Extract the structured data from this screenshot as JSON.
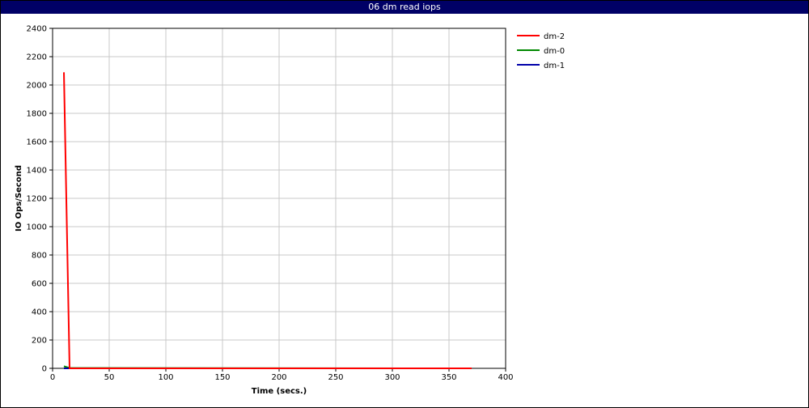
{
  "chart_data": {
    "type": "line",
    "title": "06 dm read iops",
    "xlabel": "Time (secs.)",
    "ylabel": "IO Ops/Second",
    "xlim": [
      0,
      400
    ],
    "ylim": [
      0,
      2400
    ],
    "xticks": [
      0,
      50,
      100,
      150,
      200,
      250,
      300,
      350,
      400
    ],
    "yticks": [
      0,
      200,
      400,
      600,
      800,
      1000,
      1200,
      1400,
      1600,
      1800,
      2000,
      2200,
      2400
    ],
    "grid": true,
    "legend_position": "top-right",
    "series": [
      {
        "name": "dm-2",
        "color": "#ff0000",
        "points": [
          [
            10,
            2090
          ],
          [
            15,
            0
          ],
          [
            370,
            0
          ]
        ]
      },
      {
        "name": "dm-0",
        "color": "#008800",
        "points": [
          [
            10,
            15
          ],
          [
            15,
            2
          ],
          [
            370,
            0
          ]
        ]
      },
      {
        "name": "dm-1",
        "color": "#0000aa",
        "points": [
          [
            10,
            0
          ],
          [
            15,
            0
          ],
          [
            370,
            0
          ]
        ]
      }
    ]
  }
}
